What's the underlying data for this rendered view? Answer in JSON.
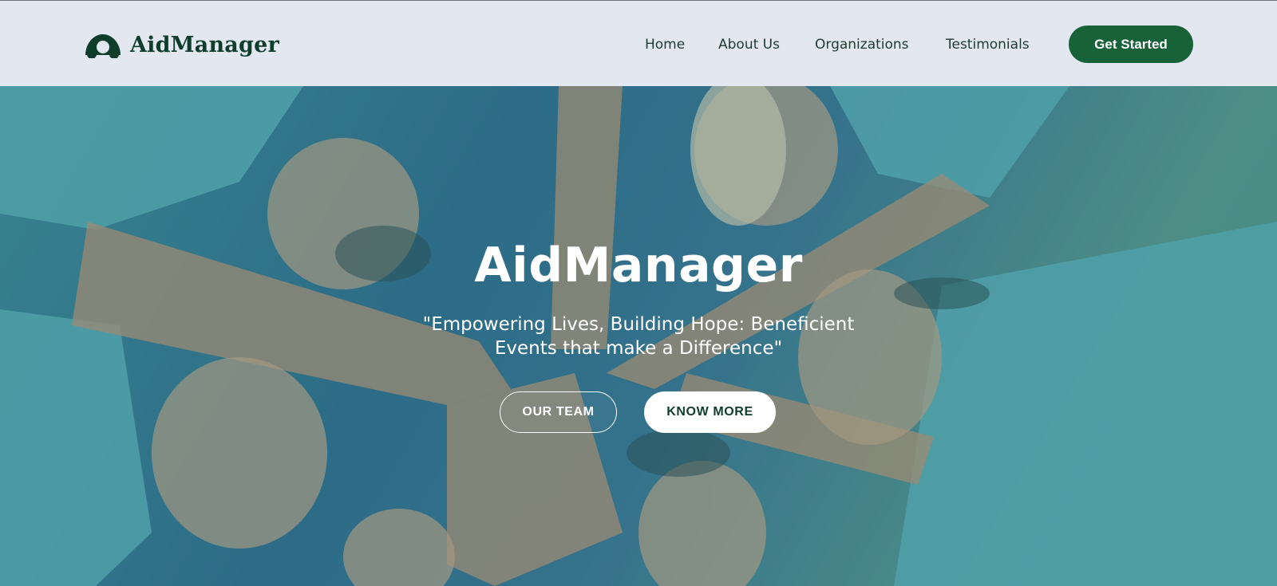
{
  "header": {
    "brand_name": "AidManager",
    "nav": [
      "Home",
      "About Us",
      "Organizations",
      "Testimonials"
    ],
    "cta_label": "Get Started"
  },
  "hero": {
    "title": "AidManager",
    "quote": "\"Empowering Lives, Building Hope: Beneficient Events that make a Difference\"",
    "buttons": {
      "team": "OUR TEAM",
      "more": "KNOW MORE"
    }
  },
  "colors": {
    "brand_green": "#176238",
    "dark_green": "#0f3d2c",
    "header_bg": "#e3e8f0"
  },
  "icons": {
    "brand": "aid-logo-icon"
  }
}
